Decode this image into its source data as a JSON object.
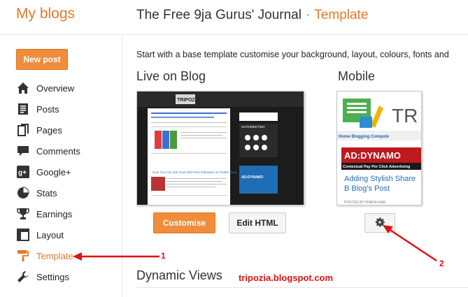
{
  "header": {
    "brand": "My blogs",
    "blog_title": "The Free 9ja Gurus' Journal",
    "separator": "·",
    "section": "Template"
  },
  "sidebar": {
    "new_post_label": "New post",
    "items": [
      {
        "label": "Overview",
        "icon": "home-icon"
      },
      {
        "label": "Posts",
        "icon": "posts-icon"
      },
      {
        "label": "Pages",
        "icon": "pages-icon"
      },
      {
        "label": "Comments",
        "icon": "comments-icon"
      },
      {
        "label": "Google+",
        "icon": "google-plus-icon"
      },
      {
        "label": "Stats",
        "icon": "stats-pie-icon"
      },
      {
        "label": "Earnings",
        "icon": "trophy-icon"
      },
      {
        "label": "Layout",
        "icon": "layout-icon"
      },
      {
        "label": "Template",
        "icon": "paint-roller-icon",
        "active": true
      },
      {
        "label": "Settings",
        "icon": "wrench-icon"
      }
    ]
  },
  "main": {
    "intro": "Start with a base template customise your background, layout, colours, fonts and",
    "live_title": "Live on Blog",
    "mobile_title": "Mobile",
    "customise_label": "Customise",
    "edit_html_label": "Edit HTML",
    "dynamic_views_title": "Dynamic Views"
  },
  "live_preview": {
    "logo_text": "TRIPOZIA",
    "post_title": "How You Can Get Over 500 Free Followers on Twitter Daily",
    "side_label_1": "GOTOMEETING",
    "side_label_2": "AD:DYNAMO"
  },
  "mobile_preview": {
    "logo_text": "TR",
    "nav_text": "Home  Blogging  Compute",
    "ad_title": "AD:DYNAMO",
    "ad_sub": "Contextual Pay Per Click Advertising",
    "post_title": "Adding Stylish Share B Blog's Post",
    "byline": "POSTED BY PHEKA KAM"
  },
  "annotations": {
    "arrow_1_label": "1",
    "arrow_2_label": "2",
    "watermark": "tripozia.blogspot.com"
  },
  "colors": {
    "accent": "#e5772a",
    "button_orange": "#f08d3c",
    "annotation_red": "#e01010"
  }
}
